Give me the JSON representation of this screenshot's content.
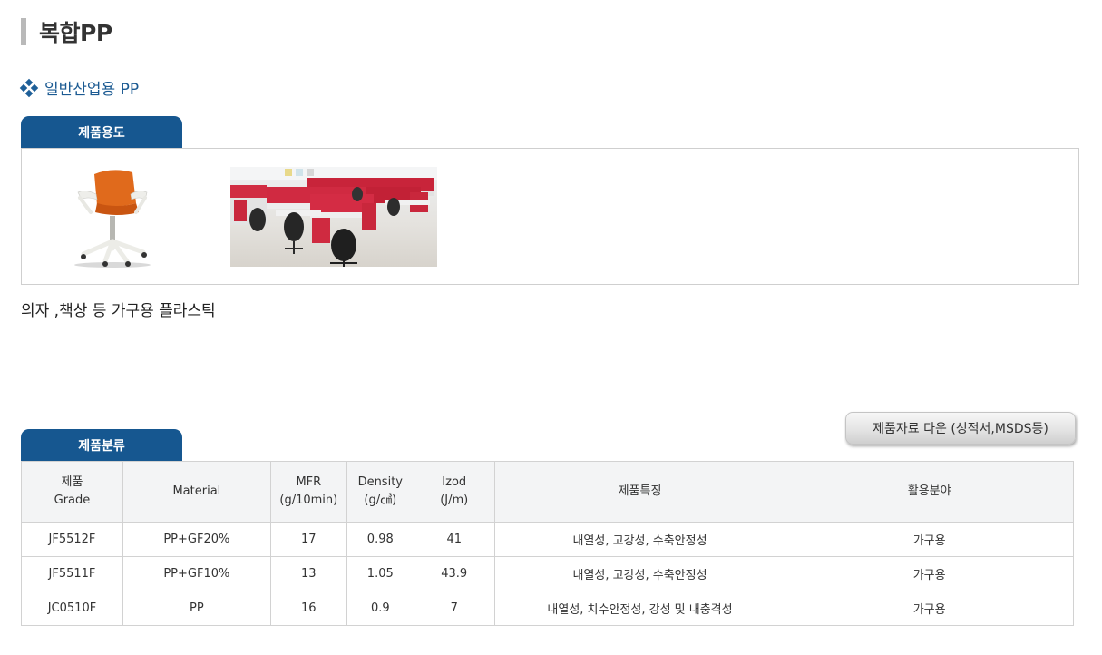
{
  "page": {
    "title": "복합PP",
    "section": "일반산업용 PP"
  },
  "usage": {
    "tab_label": "제품용도",
    "description": "의자 ,책상 등 가구용 플라스틱",
    "images": [
      "office-chair-image",
      "office-desks-image"
    ]
  },
  "classification": {
    "tab_label": "제품분류",
    "download_label": "제품자료 다운 (성적서,MSDS등)",
    "headers": [
      {
        "line1": "제품",
        "line2": "Grade"
      },
      {
        "line1": "Material",
        "line2": ""
      },
      {
        "line1": "MFR",
        "line2": "(g/10min)"
      },
      {
        "line1": "Density",
        "line2": "(g/㎤)"
      },
      {
        "line1": "Izod",
        "line2": "(J/m)"
      },
      {
        "line1": "제품특징",
        "line2": ""
      },
      {
        "line1": "활용분야",
        "line2": ""
      }
    ],
    "rows": [
      [
        "JF5512F",
        "PP+GF20%",
        "17",
        "0.98",
        "41",
        "내열성, 고강성, 수축안정성",
        "가구용"
      ],
      [
        "JF5511F",
        "PP+GF10%",
        "13",
        "1.05",
        "43.9",
        "내열성, 고강성, 수축안정성",
        "가구용"
      ],
      [
        "JC0510F",
        "PP",
        "16",
        "0.9",
        "7",
        "내열성, 치수안정성, 강성 및 내충격성",
        "가구용"
      ]
    ]
  },
  "colors": {
    "tab_background": "#165790",
    "section_text": "#1b5a92",
    "title_bar": "#b9b9b9",
    "header_background": "#f3f4f5"
  }
}
